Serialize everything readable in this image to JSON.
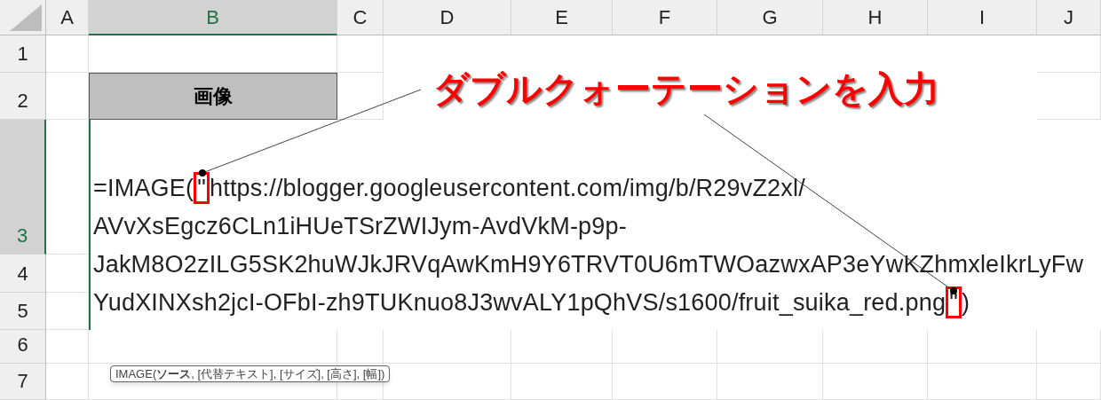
{
  "columns": [
    {
      "label": "A",
      "selected": false
    },
    {
      "label": "B",
      "selected": true
    },
    {
      "label": "C",
      "selected": false
    },
    {
      "label": "D",
      "selected": false
    },
    {
      "label": "E",
      "selected": false
    },
    {
      "label": "F",
      "selected": false
    },
    {
      "label": "G",
      "selected": false
    },
    {
      "label": "H",
      "selected": false
    },
    {
      "label": "I",
      "selected": false
    },
    {
      "label": "J",
      "selected": false
    }
  ],
  "rows": [
    {
      "label": "1",
      "selected": false
    },
    {
      "label": "2",
      "selected": false
    },
    {
      "label": "3",
      "selected": true
    },
    {
      "label": "4",
      "selected": false
    },
    {
      "label": "5",
      "selected": false
    },
    {
      "label": "6",
      "selected": false
    },
    {
      "label": "7",
      "selected": false
    }
  ],
  "header_cell": {
    "text": "画像"
  },
  "formula_lines": [
    [
      {
        "text": "=IMAGE(",
        "boxed": false
      },
      {
        "text": "\"",
        "boxed": true
      },
      {
        "text": "https://blogger.googleusercontent.com/img/b/R29vZ2xl/",
        "boxed": false
      }
    ],
    [
      {
        "text": "AVvXsEgcz6CLn1iHUeTSrZWIJym-AvdVkM-p9p-",
        "boxed": false
      }
    ],
    [
      {
        "text": "JakM8O2zILG5SK2huWJkJRVqAwKmH9Y6TRVT0U6mTWOazwxAP3eYwKZhmxleIkrLyFw",
        "boxed": false
      }
    ],
    [
      {
        "text": "YudXINXsh2jcI-OFbI-zh9TUKnuo8J3wvALY1pQhVS/s1600/fruit_suika_red.png",
        "boxed": false
      },
      {
        "text": "\"",
        "boxed": true
      },
      {
        "text": ")",
        "boxed": false
      }
    ]
  ],
  "callout": "ダブルクォーテーションを入力",
  "tooltip": "IMAGE(**ソース**, [代替テキスト], [サイズ], [高さ], [幅])"
}
